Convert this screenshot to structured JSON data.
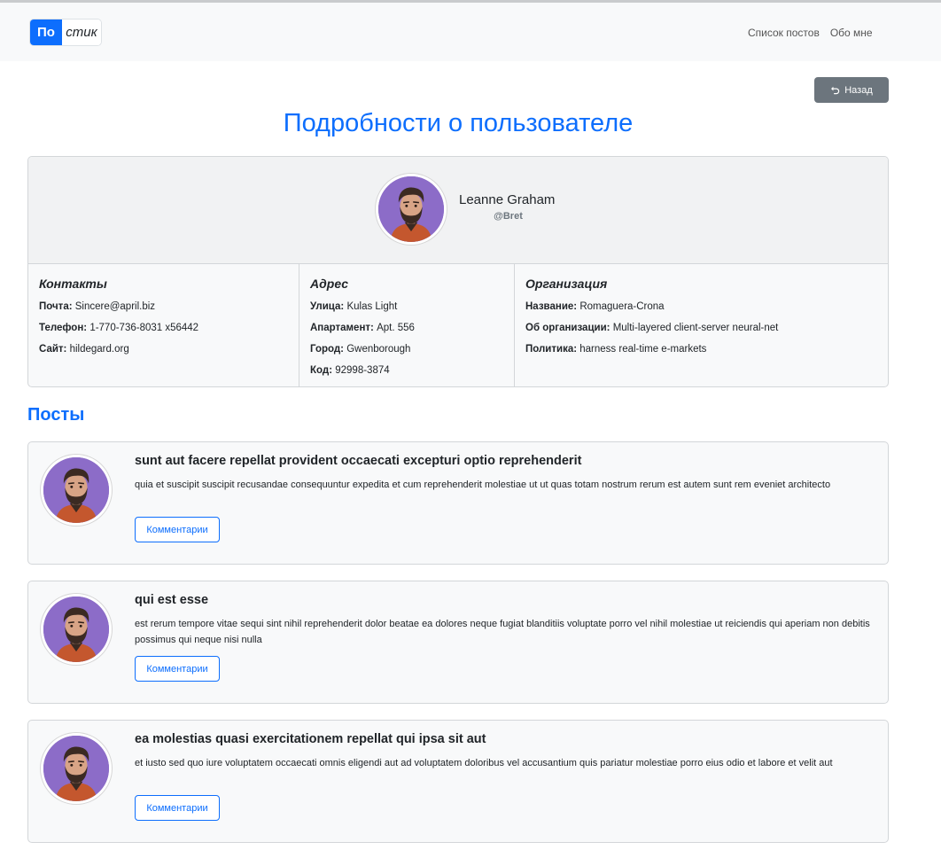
{
  "navbar": {
    "logo_part1": "По",
    "logo_part2": "стик",
    "links": [
      {
        "label": "Список постов"
      },
      {
        "label": "Обо мне"
      }
    ]
  },
  "back_button": {
    "label": "Назад",
    "icon": "undo-arrow-icon"
  },
  "page_title": "Подробности о пользователе",
  "user": {
    "name": "Leanne Graham",
    "username": "@Bret",
    "contacts": {
      "title": "Контакты",
      "email_label": "Почта:",
      "email": "Sincere@april.biz",
      "phone_label": "Телефон:",
      "phone": "1-770-736-8031 x56442",
      "site_label": "Сайт:",
      "site": "hildegard.org"
    },
    "address": {
      "title": "Адрес",
      "street_label": "Улица:",
      "street": "Kulas Light",
      "suite_label": "Апартамент:",
      "suite": "Apt. 556",
      "city_label": "Город:",
      "city": "Gwenborough",
      "zip_label": "Код:",
      "zip": "92998-3874"
    },
    "company": {
      "title": "Организация",
      "name_label": "Название:",
      "name": "Romaguera-Crona",
      "catch_label": "Об организации:",
      "catch": "Multi-layered client-server neural-net",
      "bs_label": "Политика:",
      "bs": "harness real-time e-markets"
    }
  },
  "posts_title": "Посты",
  "posts": [
    {
      "title": "sunt aut facere repellat provident occaecati excepturi optio reprehenderit",
      "body": "quia et suscipit suscipit recusandae consequuntur expedita et cum reprehenderit molestiae ut ut quas totam nostrum rerum est autem sunt rem eveniet architecto",
      "button": "Комментарии"
    },
    {
      "title": "qui est esse",
      "body": "est rerum tempore vitae sequi sint nihil reprehenderit dolor beatae ea dolores neque fugiat blanditiis voluptate porro vel nihil molestiae ut reiciendis qui aperiam non debitis possimus qui neque nisi nulla",
      "button": "Комментарии"
    },
    {
      "title": "ea molestias quasi exercitationem repellat qui ipsa sit aut",
      "body": "et iusto sed quo iure voluptatem occaecati omnis eligendi aut ad voluptatem doloribus vel accusantium quis pariatur molestiae porro eius odio et labore et velit aut",
      "button": "Комментарии"
    }
  ],
  "colors": {
    "primary": "#0d6efd",
    "secondary": "#6c757d",
    "navbar_bg": "#f8f9fa",
    "avatar_bg": "#8c6cc8"
  }
}
